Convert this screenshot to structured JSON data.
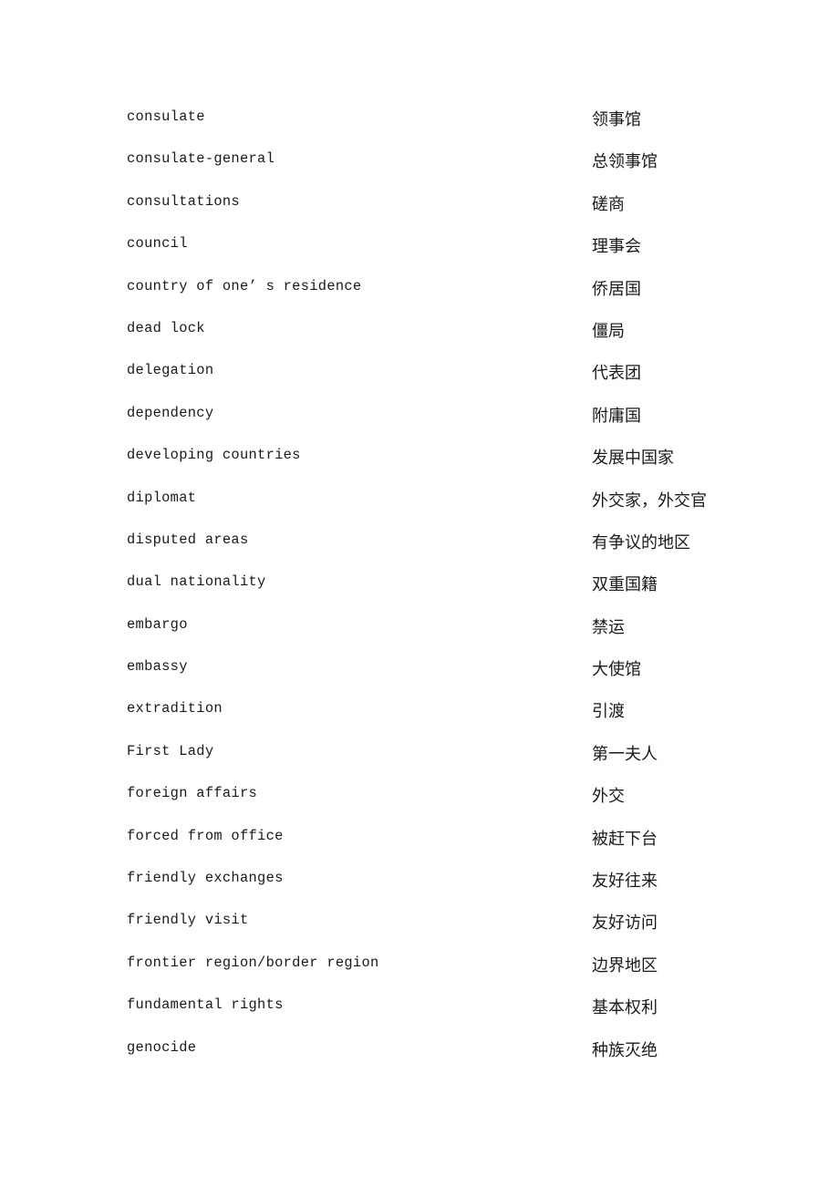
{
  "document": {
    "entries": [
      {
        "en": "consulate",
        "zh": "领事馆"
      },
      {
        "en": "consulate-general",
        "zh": "总领事馆"
      },
      {
        "en": "consultations",
        "zh": "磋商"
      },
      {
        "en": "council",
        "zh": "理事会"
      },
      {
        "en": "country of one’ s residence",
        "zh": "侨居国"
      },
      {
        "en": "dead lock",
        "zh": "僵局"
      },
      {
        "en": "delegation",
        "zh": "代表团"
      },
      {
        "en": "dependency",
        "zh": "附庸国"
      },
      {
        "en": "developing countries",
        "zh": "发展中国家"
      },
      {
        "en": "diplomat",
        "zh": "外交家，外交官"
      },
      {
        "en": "disputed areas",
        "zh": "有争议的地区"
      },
      {
        "en": "dual nationality",
        "zh": "双重国籍"
      },
      {
        "en": "embargo",
        "zh": "禁运"
      },
      {
        "en": "embassy",
        "zh": "大使馆"
      },
      {
        "en": "extradition",
        "zh": "引渡"
      },
      {
        "en": "First Lady",
        "zh": "第一夫人"
      },
      {
        "en": "foreign affairs",
        "zh": "外交"
      },
      {
        "en": "forced from office",
        "zh": "被赶下台"
      },
      {
        "en": "friendly exchanges",
        "zh": "友好往来"
      },
      {
        "en": "friendly visit",
        "zh": "友好访问"
      },
      {
        "en": "frontier region/border region",
        "zh": "边界地区"
      },
      {
        "en": "fundamental rights",
        "zh": "基本权利"
      },
      {
        "en": "genocide",
        "zh": "种族灭绝"
      }
    ]
  }
}
